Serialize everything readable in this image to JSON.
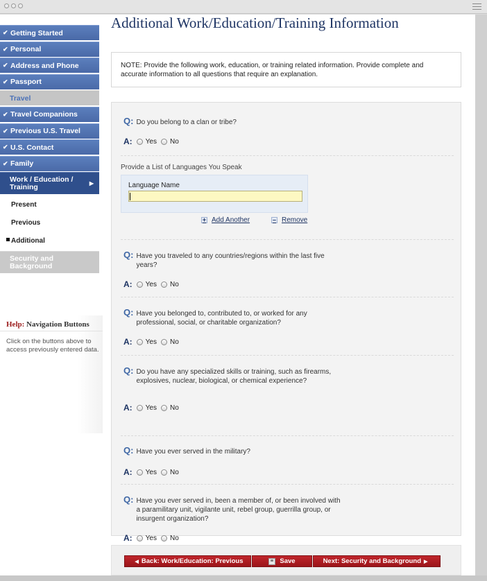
{
  "nav": {
    "items": [
      {
        "label": "Getting Started"
      },
      {
        "label": "Personal"
      },
      {
        "label": "Address and Phone"
      },
      {
        "label": "Passport"
      },
      {
        "label": "Travel"
      },
      {
        "label": "Travel Companions"
      },
      {
        "label": "Previous U.S. Travel"
      },
      {
        "label": "U.S. Contact"
      },
      {
        "label": "Family"
      }
    ],
    "active": {
      "label": "Work / Education / Training"
    },
    "subitems": [
      {
        "label": "Present"
      },
      {
        "label": "Previous"
      },
      {
        "label": "Additional"
      }
    ],
    "disabled": {
      "label": "Security and Background"
    }
  },
  "help": {
    "title_prefix": "Help:",
    "title": "Navigation Buttons",
    "text": "Click on the buttons above to access previously entered data."
  },
  "page": {
    "title": "Additional Work/Education/Training Information",
    "note": "NOTE: Provide the following work, education, or training related information. Provide complete and accurate information to all questions that require an explanation."
  },
  "labels": {
    "q": "Q:",
    "a": "A:",
    "yes": "Yes",
    "no": "No"
  },
  "questions": [
    {
      "text": "Do you belong to a clan or tribe?"
    },
    {
      "text": "Have you traveled to any countries/regions within the last five years?"
    },
    {
      "text": "Have you belonged to, contributed to, or worked for any professional, social, or charitable organization?"
    },
    {
      "text": "Do you have any specialized skills or training, such as firearms, explosives, nuclear, biological, or chemical experience?"
    },
    {
      "text": "Have you ever served in the military?"
    },
    {
      "text": "Have you ever served in, been a member of, or been involved with a paramilitary unit, vigilante unit, rebel group, guerrilla group, or insurgent organization?"
    }
  ],
  "languages": {
    "heading": "Provide a List of Languages You Speak",
    "field_label": "Language Name",
    "value": "",
    "add": "Add Another",
    "remove": "Remove"
  },
  "buttons": {
    "back": "Back: Work/Education: Previous",
    "save": "Save",
    "next": "Next: Security and Background"
  }
}
